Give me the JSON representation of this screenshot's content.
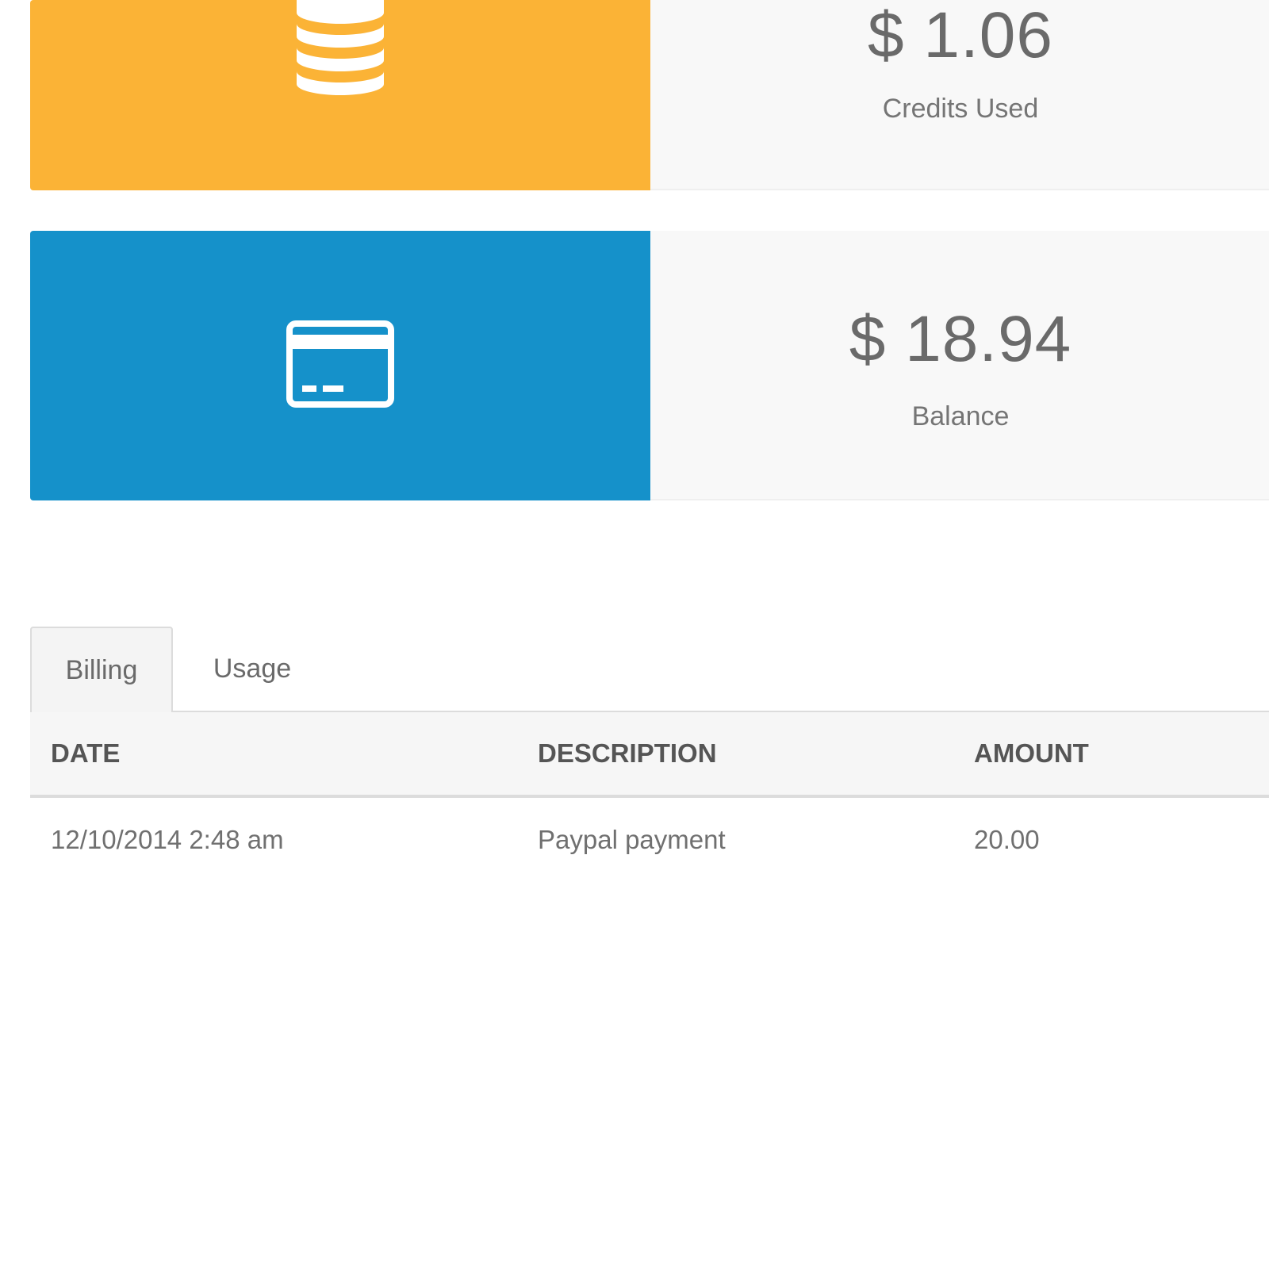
{
  "stats": {
    "credits_used": {
      "value": "$ 1.06",
      "label": "Credits Used",
      "icon": "coins-stack-icon",
      "color": "#FBB336"
    },
    "balance": {
      "value": "$ 18.94",
      "label": "Balance",
      "icon": "credit-card-icon",
      "color": "#1591CA"
    }
  },
  "tabs": [
    {
      "label": "Billing",
      "active": true
    },
    {
      "label": "Usage",
      "active": false
    }
  ],
  "table": {
    "columns": [
      "DATE",
      "DESCRIPTION",
      "AMOUNT"
    ],
    "rows": [
      [
        "12/10/2014 2:48 am",
        "Paypal payment",
        "20.00"
      ]
    ]
  }
}
